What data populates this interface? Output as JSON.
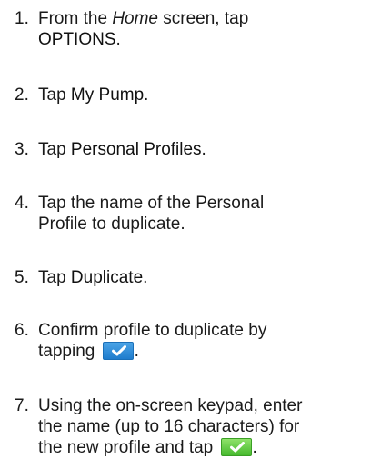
{
  "steps": [
    {
      "num": "1.",
      "before": "From the ",
      "em": "Home",
      "after": " screen, tap",
      "ui": "OPTIONS",
      "end": "."
    },
    {
      "num": "2.",
      "before": "Tap ",
      "ui": "My Pump",
      "end": "."
    },
    {
      "num": "3.",
      "before": "Tap ",
      "ui": "Personal Profiles",
      "end": "."
    },
    {
      "num": "4.",
      "line1": "Tap the name of the Personal",
      "line2": "Profile to duplicate."
    },
    {
      "num": "5.",
      "before": "Tap ",
      "ui": "Duplicate",
      "end": "."
    },
    {
      "num": "6.",
      "line1": "Confirm profile to duplicate by",
      "line2": "tapping",
      "end": "."
    },
    {
      "num": "7.",
      "line1": "Using the on-screen keypad, enter",
      "line2": "the name (up to 16 characters) for",
      "line3": "the new profile and tap",
      "end": "."
    }
  ],
  "icons": {
    "confirm_blue": "checkmark-button-icon",
    "confirm_green": "checkmark-button-icon",
    "confirm_blue_color": "#2a8ad8",
    "confirm_green_color": "#5cc83c"
  }
}
